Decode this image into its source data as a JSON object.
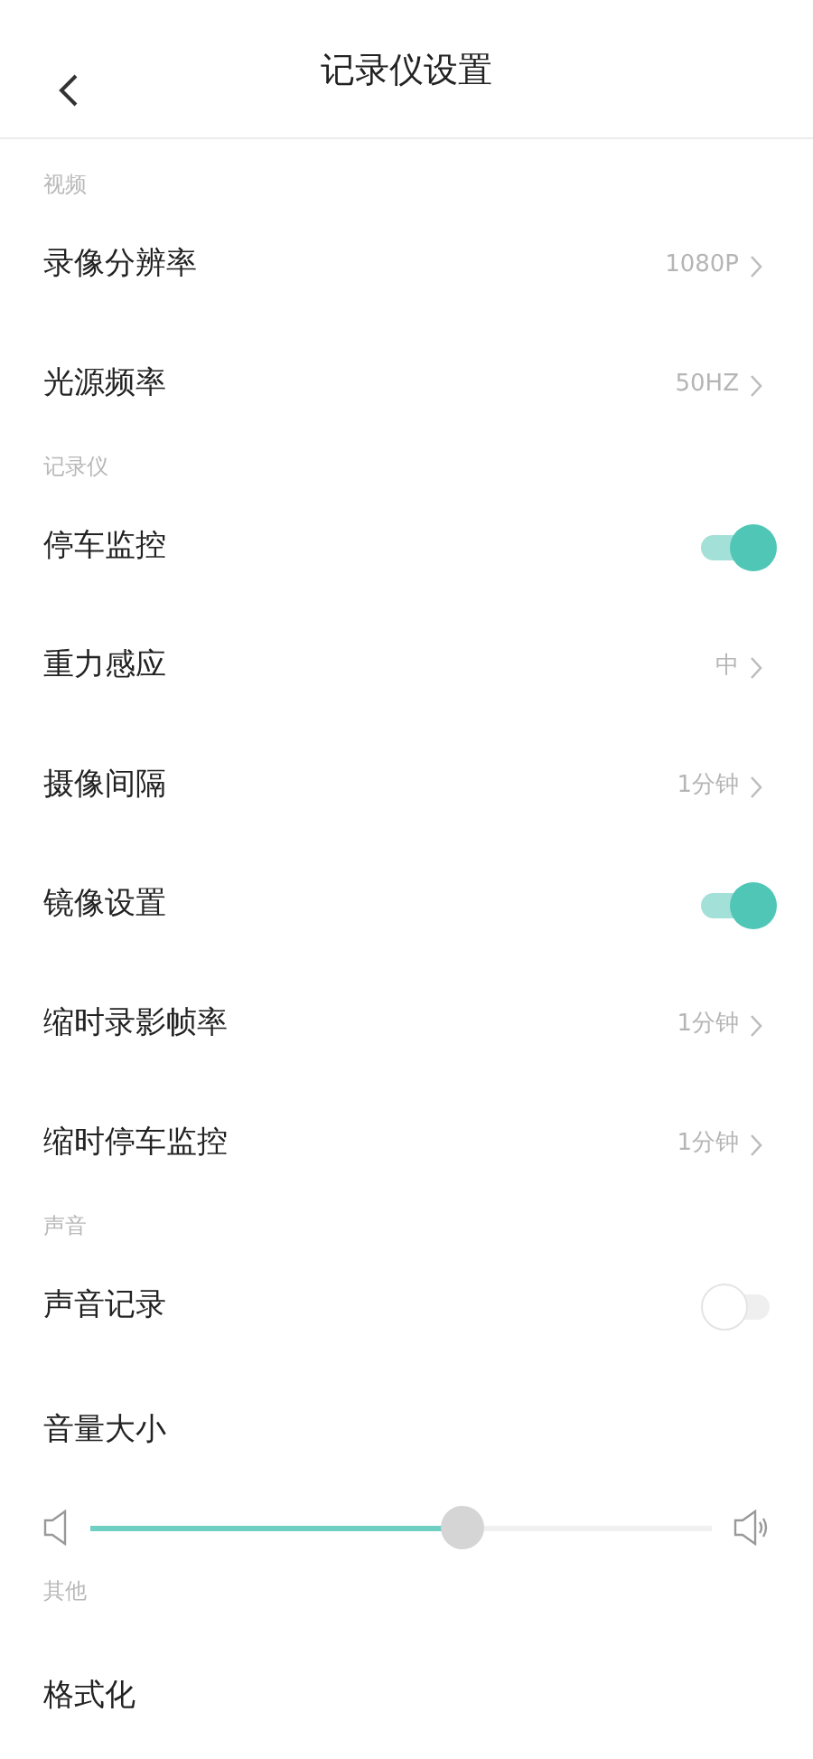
{
  "header": {
    "title": "记录仪设置"
  },
  "sections": [
    {
      "label": "视频",
      "items": [
        {
          "kind": "value",
          "label": "录像分辨率",
          "value": "1080P"
        },
        {
          "kind": "value",
          "label": "光源频率",
          "value": "50HZ"
        }
      ]
    },
    {
      "label": "记录仪",
      "items": [
        {
          "kind": "toggle",
          "label": "停车监控",
          "on": true
        },
        {
          "kind": "value",
          "label": "重力感应",
          "value": "中"
        },
        {
          "kind": "value",
          "label": "摄像间隔",
          "value": "1分钟"
        },
        {
          "kind": "toggle",
          "label": "镜像设置",
          "on": true
        },
        {
          "kind": "value",
          "label": "缩时录影帧率",
          "value": "1分钟"
        },
        {
          "kind": "value",
          "label": "缩时停车监控",
          "value": "1分钟"
        }
      ]
    },
    {
      "label": "声音",
      "items": [
        {
          "kind": "toggle",
          "label": "声音记录",
          "on": false
        },
        {
          "kind": "slider",
          "label": "音量大小",
          "level": 0.6
        }
      ]
    },
    {
      "label": "其他",
      "items": [
        {
          "kind": "action",
          "label": "格式化"
        }
      ]
    }
  ]
}
